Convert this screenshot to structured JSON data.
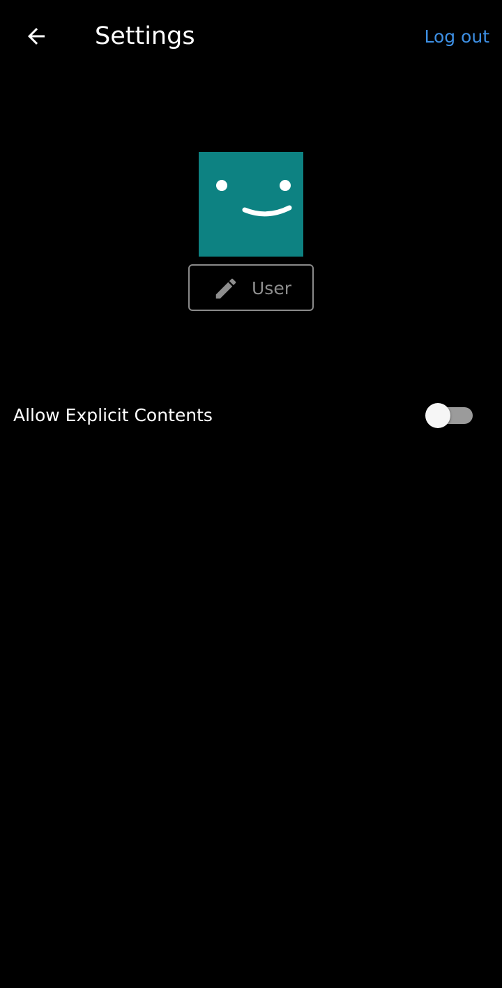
{
  "header": {
    "back_icon": "arrow-left-icon",
    "title": "Settings",
    "logout_label": "Log out"
  },
  "profile": {
    "avatar_icon": "smiley-face-icon",
    "edit_icon": "pencil-icon",
    "name": "User"
  },
  "settings": {
    "explicit_label": "Allow Explicit Contents",
    "explicit_enabled": false
  },
  "colors": {
    "background": "#000000",
    "accent_link": "#3d8fe3",
    "avatar_bg": "#0d8282",
    "toggle_track_off": "#9b9b9b",
    "toggle_thumb": "#f6f6f6"
  }
}
